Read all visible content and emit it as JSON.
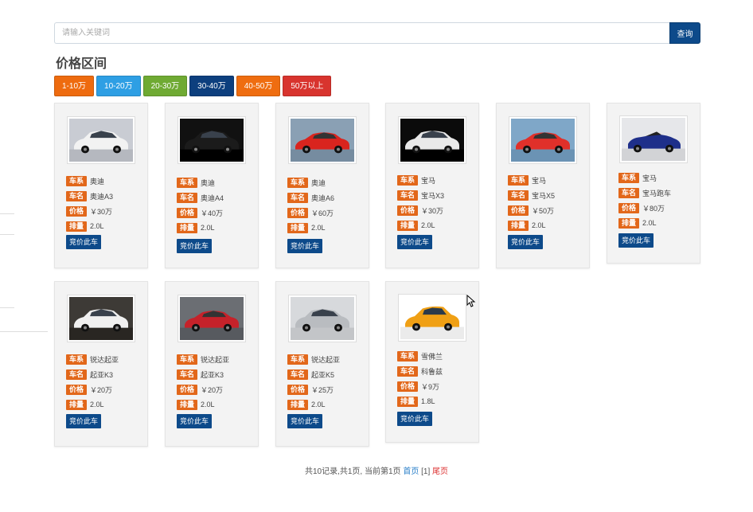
{
  "search": {
    "placeholder": "请输入关键词",
    "button_label": "查询"
  },
  "section": {
    "title": "价格区间"
  },
  "price_filters": [
    {
      "label": "1-10万",
      "color": "#ee6b0f"
    },
    {
      "label": "10-20万",
      "color": "#2e9fe4"
    },
    {
      "label": "20-30万",
      "color": "#6faa33"
    },
    {
      "label": "30-40万",
      "color": "#0d3f7e"
    },
    {
      "label": "40-50万",
      "color": "#ef6d10"
    },
    {
      "label": "50万以上",
      "color": "#d8342e"
    }
  ],
  "labels": {
    "series": "车系",
    "name": "车名",
    "price": "价格",
    "displacement": "排量",
    "bid_button": "竞价此车"
  },
  "cars": [
    {
      "series": "奥迪",
      "name": "奥迪A3",
      "price": "￥30万",
      "displacement": "2.0L",
      "image": "white-sedan",
      "body_color": "#f2f2f2",
      "bg_color": "#c9ccd3"
    },
    {
      "series": "奥迪",
      "name": "奥迪A4",
      "price": "￥40万",
      "displacement": "2.0L",
      "image": "black-sedan",
      "body_color": "#1b1b1b",
      "bg_color": "#111111"
    },
    {
      "series": "奥迪",
      "name": "奥迪A6",
      "price": "￥60万",
      "displacement": "2.0L",
      "image": "red-coupe",
      "body_color": "#d9241e",
      "bg_color": "#8aa0b4"
    },
    {
      "series": "宝马",
      "name": "宝马X3",
      "price": "￥30万",
      "displacement": "2.0L",
      "image": "white-sedan",
      "body_color": "#e9e9e9",
      "bg_color": "#0b0b0b"
    },
    {
      "series": "宝马",
      "name": "宝马X5",
      "price": "￥50万",
      "displacement": "2.0L",
      "image": "red-sedan",
      "body_color": "#e0302a",
      "bg_color": "#7fa7c8"
    },
    {
      "series": "宝马",
      "name": "宝马跑车",
      "price": "￥80万",
      "displacement": "2.0L",
      "image": "blue-convertible",
      "body_color": "#1e2f8a",
      "bg_color": "#e6e7ea"
    },
    {
      "series": "锐达起亚",
      "name": "起亚K3",
      "price": "￥20万",
      "displacement": "2.0L",
      "image": "white-sedan",
      "body_color": "#f0f0f0",
      "bg_color": "#3d3a36"
    },
    {
      "series": "锐达起亚",
      "name": "起亚K3",
      "price": "￥20万",
      "displacement": "2.0L",
      "image": "red-coupe",
      "body_color": "#c5222a",
      "bg_color": "#6b6e73"
    },
    {
      "series": "锐达起亚",
      "name": "起亚K5",
      "price": "￥25万",
      "displacement": "2.0L",
      "image": "silver-sedan",
      "body_color": "#b9bcc0",
      "bg_color": "#d7d9dc"
    },
    {
      "series": "雪佛兰",
      "name": "科鲁兹",
      "price": "￥9万",
      "displacement": "1.8L",
      "image": "orange-hatch",
      "body_color": "#f0a015",
      "bg_color": "#ffffff"
    }
  ],
  "pagination": {
    "summary": "共10记录,共1页, 当前第1页",
    "first": "首页",
    "current": "[1]",
    "last": "尾页"
  }
}
